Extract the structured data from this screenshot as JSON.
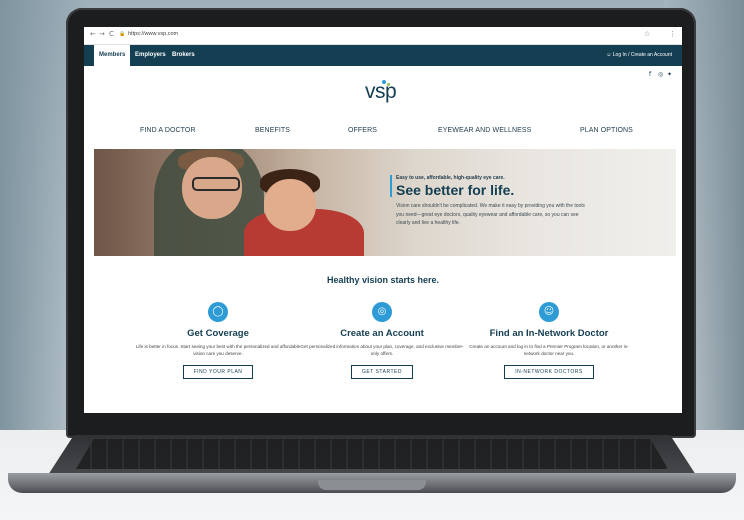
{
  "browser": {
    "back": "←",
    "forward": "→",
    "reload": "C",
    "url": "https://www.vsp.com",
    "star": "☆",
    "menu": "⋮"
  },
  "topnav": {
    "tabs": [
      "Members",
      "Employers",
      "Brokers"
    ],
    "account": "Log In / Create an Account",
    "account_icon": "person-icon"
  },
  "social": {
    "icons": [
      "facebook-icon",
      "instagram-icon",
      "twitter-icon"
    ],
    "glyphs": [
      "f",
      "◎",
      "✦"
    ]
  },
  "logo": {
    "text": "vsp",
    "colors": {
      "dot": "#2d9bd5",
      "leaf": "#8fc550"
    }
  },
  "menu": [
    "FIND A DOCTOR",
    "BENEFITS",
    "OFFERS",
    "EYEWEAR AND WELLNESS",
    "PLAN OPTIONS"
  ],
  "hero": {
    "kicker": "Easy to use, affordable, high-quality eye care.",
    "title": "See better for life.",
    "body": "Vision care shouldn't be complicated. We make it easy by providing you with the tools you need—great eye doctors, quality eyewear and affordable care, so you can see clearly and live a healthy life."
  },
  "tagline": "Healthy vision starts here.",
  "features": [
    {
      "icon": "lightbulb-icon",
      "glyph": "💡",
      "title": "Get Coverage",
      "body": "Life is better in focus. Start seeing your best with the personalized and affordable vision care you deserve.",
      "button": "FIND YOUR PLAN"
    },
    {
      "icon": "glasses-icon",
      "glyph": "👓",
      "title": "Create an Account",
      "body": "Get personalized information about your plan, coverage, and exclusive member-only offers.",
      "button": "GET STARTED"
    },
    {
      "icon": "doctor-icon",
      "glyph": "☺",
      "title": "Find an In-Network Doctor",
      "body": "Create an account and log in to find a Premier Program location, or another in-network doctor near you.",
      "button": "IN-NETWORK DOCTORS"
    }
  ],
  "colors": {
    "navy": "#143e51",
    "accent": "#2d9bd5"
  }
}
